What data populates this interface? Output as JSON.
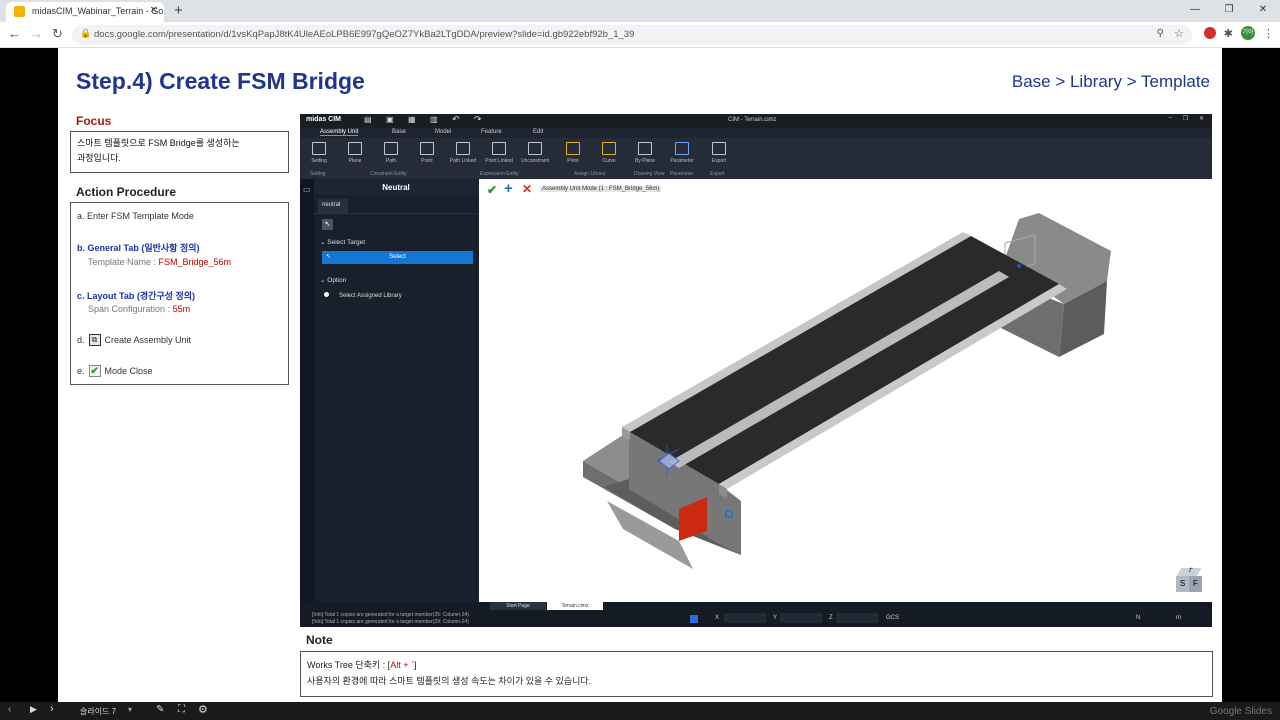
{
  "browser": {
    "tab_title": "midasCIM_Wabinar_Terrain - Go",
    "url": "docs.google.com/presentation/d/1vsKqPapJ8tK4UleAEoLPB6E997gQeOZ7YkBa2LTgDDA/preview?slide=id.gb922ebf92b_1_39",
    "profile": "기아"
  },
  "slide": {
    "title": "Step.4) Create FSM Bridge",
    "breadcrumb": "Base > Library > Template",
    "focus": {
      "heading": "Focus",
      "line1": "스마트 템플릿으로 FSM Bridge를 생성하는",
      "line2": "과정입니다."
    },
    "action": {
      "heading": "Action Procedure",
      "a": "a. Enter FSM Template Mode",
      "b": "b. General Tab (일반사항 정의)",
      "b_sub_label": "Template Name : ",
      "b_sub_value": "FSM_Bridge_56m",
      "c": "c. Layout Tab (경간구성 정의)",
      "c_sub_label": "Span Configuration : ",
      "c_sub_value": "55m",
      "d": "Create Assembly Unit",
      "d_prefix": "d.",
      "e": "Mode Close",
      "e_prefix": "e."
    },
    "note": {
      "heading": "Note",
      "line1_label": "Works Tree 단축키 : [",
      "line1_key": "Alt + `",
      "line1_end": "]",
      "line2": "사용자의 환경에 따라 스마트 템플릿의 생성 속도는 차이가 있을 수 있습니다."
    }
  },
  "cim": {
    "logo": "midas CIM",
    "window_title": "CIM - Terrain.cimz",
    "menu": [
      "Assembly Unit",
      "Base",
      "Model",
      "Feature",
      "Edit"
    ],
    "ribbon": [
      "Setting",
      "Plane",
      "Path",
      "Point",
      "Path Linked",
      "Point Linked",
      "Unconstraint",
      "Point",
      "Curve",
      "By Plane",
      "Parameter",
      "Export"
    ],
    "groups": [
      "Setting",
      "Constraint Entity",
      "Expression Entity",
      "Assign Library",
      "Drawing View",
      "Parameter",
      "Export"
    ],
    "panel_title": "Neutral",
    "panel_tab": "neutral",
    "select_target": "Select Target",
    "select_button": "Select",
    "option": "Option",
    "option_item": "Select Assigned Library",
    "mode_label": "Assembly Unit Mode (1 : FSM_Bridge_56m)",
    "log1": "[Info] Total 1 copies are generated for a target member(25: Column-24)",
    "log2": "[Info] Total 1 copies are generated for a target member(29: Column-24)",
    "tabs": [
      "Start Page",
      "Terrain.cimz"
    ],
    "coord_x": "X",
    "coord_y": "Y",
    "coord_z": "Z",
    "gcs": "GCS",
    "unit_n": "N",
    "unit_m": "m",
    "cube_labels": [
      "T",
      "F",
      "S"
    ]
  },
  "controls": {
    "slide_select": "슬라이드 7",
    "brand": "Google Slides"
  },
  "colors": {
    "title_blue": "#1f3590",
    "accent_red": "#c00000",
    "select_blue": "#1477d4"
  }
}
